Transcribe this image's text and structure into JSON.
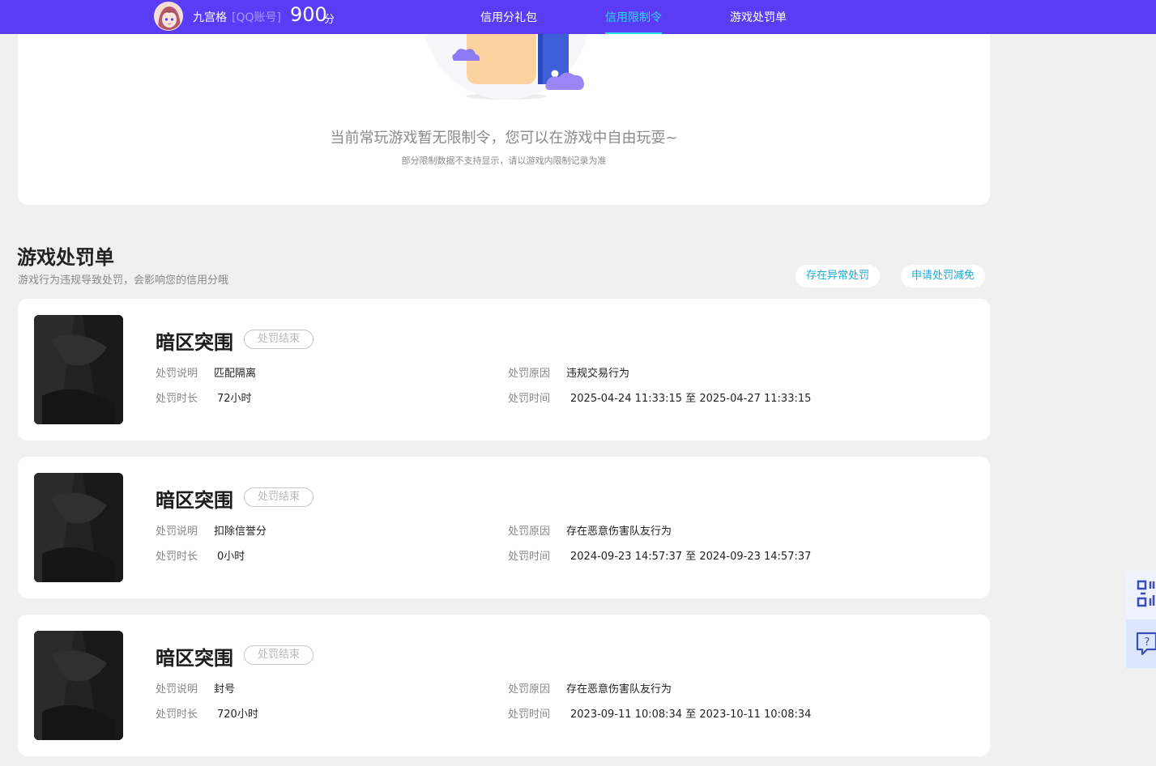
{
  "header": {
    "user_name": "九宫格",
    "account_type": "[QQ账号]",
    "score": "900",
    "score_unit": "分",
    "tabs": [
      {
        "label": "信用分礼包",
        "active": false
      },
      {
        "label": "信用限制令",
        "active": true
      },
      {
        "label": "游戏处罚单",
        "active": false
      }
    ],
    "colors": {
      "bar": "#5b3cf5",
      "active_tab": "#2ed9f0"
    }
  },
  "restriction": {
    "empty_title": "当前常玩游戏暂无限制令，您可以在游戏中自由玩耍~",
    "empty_note": "部分限制数据不支持显示，请以游戏内限制记录为准"
  },
  "penalties": {
    "title": "游戏处罚单",
    "subtitle": "游戏行为违规导致处罚，会影响您的信用分哦",
    "actions": {
      "abnormal_label": "存在异常处罚",
      "appeal_label": "申请处罚减免"
    },
    "field_labels": {
      "description": "处罚说明",
      "reason": "处罚原因",
      "duration": "处罚时长",
      "time": "处罚时间"
    },
    "items": [
      {
        "game": "暗区突围",
        "status": "处罚结束",
        "description": "匹配隔离",
        "reason": "违规交易行为",
        "duration": "72小时",
        "time": "2025-04-24 11:33:15 至 2025-04-27 11:33:15"
      },
      {
        "game": "暗区突围",
        "status": "处罚结束",
        "description": "扣除信誉分",
        "reason": "存在恶意伤害队友行为",
        "duration": "0小时",
        "time": "2024-09-23 14:57:37 至 2024-09-23 14:57:37"
      },
      {
        "game": "暗区突围",
        "status": "处罚结束",
        "description": "封号",
        "reason": "存在恶意伤害队友行为",
        "duration": "720小时",
        "time": "2023-09-11 10:08:34 至 2023-10-11 10:08:34"
      }
    ]
  },
  "floating_tools": [
    {
      "icon": "qr-code-icon"
    },
    {
      "icon": "help-chat-icon"
    }
  ]
}
